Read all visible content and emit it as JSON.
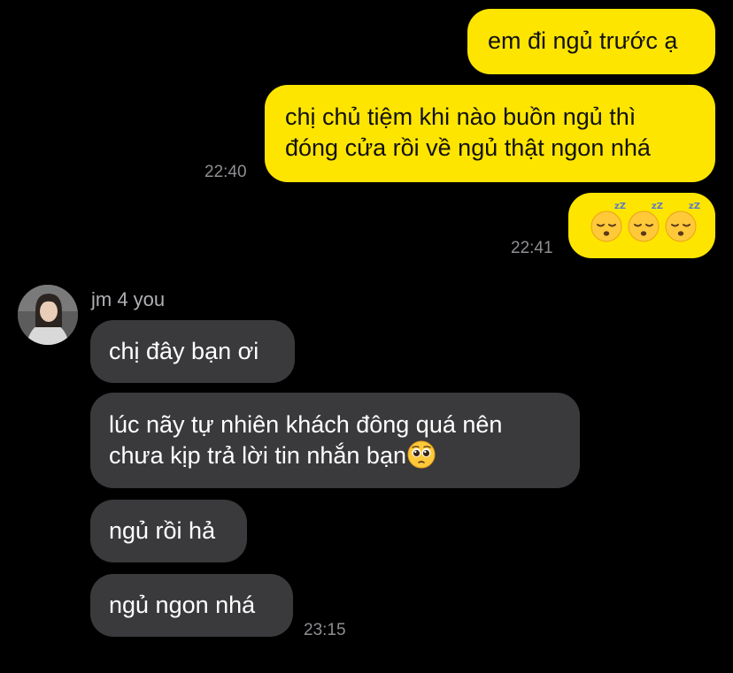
{
  "colors": {
    "background": "#000000",
    "sent_bubble": "#FEE500",
    "received_bubble": "#3a3a3c",
    "timestamp": "#8e8e93"
  },
  "outgoing": [
    {
      "text": "em đi ngủ trước ạ"
    },
    {
      "lines": [
        "chị chủ tiệm khi nào buồn ngủ thì",
        "đóng cửa rồi về ngủ thật ngon nhá"
      ],
      "time": "22:40"
    },
    {
      "emoji": [
        "sleeping-face-icon",
        "sleeping-face-icon",
        "sleeping-face-icon"
      ],
      "time": "22:41"
    }
  ],
  "contact": {
    "name": "jm 4 you",
    "avatar": "profile-photo"
  },
  "incoming": [
    {
      "text": "chị đây bạn ơi"
    },
    {
      "lines": [
        "lúc nãy tự nhiên khách đông quá nên",
        "chưa kịp trả lời tin nhắn bạn"
      ],
      "emoji": "pleading-face-icon"
    },
    {
      "text": "ngủ rồi hả"
    },
    {
      "text": "ngủ ngon nhá",
      "time": "23:15"
    }
  ]
}
